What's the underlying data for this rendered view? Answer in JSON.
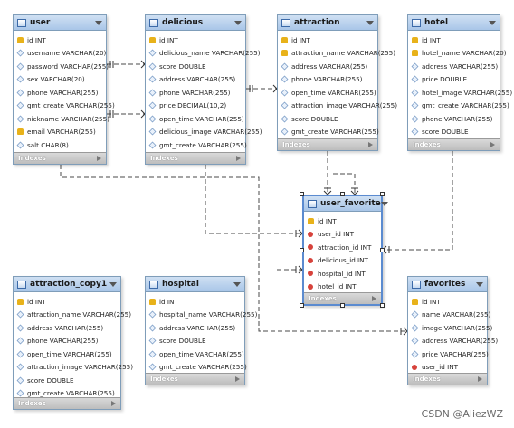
{
  "tables": [
    {
      "name": "user",
      "columns": [
        {
          "icon": "key",
          "text": "id INT"
        },
        {
          "icon": "col",
          "text": "username VARCHAR(20)"
        },
        {
          "icon": "col",
          "text": "password VARCHAR(255)"
        },
        {
          "icon": "col",
          "text": "sex VARCHAR(20)"
        },
        {
          "icon": "col",
          "text": "phone VARCHAR(255)"
        },
        {
          "icon": "col",
          "text": "gmt_create VARCHAR(255)"
        },
        {
          "icon": "col",
          "text": "nickname VARCHAR(255)"
        },
        {
          "icon": "key",
          "text": "email VARCHAR(255)"
        },
        {
          "icon": "col",
          "text": "salt CHAR(8)"
        }
      ],
      "footer": "Indexes"
    },
    {
      "name": "delicious",
      "columns": [
        {
          "icon": "key",
          "text": "id INT"
        },
        {
          "icon": "col",
          "text": "delicious_name VARCHAR(255)"
        },
        {
          "icon": "col",
          "text": "score DOUBLE"
        },
        {
          "icon": "col",
          "text": "address VARCHAR(255)"
        },
        {
          "icon": "col",
          "text": "phone VARCHAR(255)"
        },
        {
          "icon": "col",
          "text": "price DECIMAL(10,2)"
        },
        {
          "icon": "col",
          "text": "open_time VARCHAR(255)"
        },
        {
          "icon": "col",
          "text": "delicious_image VARCHAR(255)"
        },
        {
          "icon": "col",
          "text": "gmt_create VARCHAR(255)"
        }
      ],
      "footer": "Indexes"
    },
    {
      "name": "attraction",
      "columns": [
        {
          "icon": "key",
          "text": "id INT"
        },
        {
          "icon": "key",
          "text": "attraction_name VARCHAR(255)"
        },
        {
          "icon": "col",
          "text": "address VARCHAR(255)"
        },
        {
          "icon": "col",
          "text": "phone VARCHAR(255)"
        },
        {
          "icon": "col",
          "text": "open_time VARCHAR(255)"
        },
        {
          "icon": "col",
          "text": "attraction_image VARCHAR(255)"
        },
        {
          "icon": "col",
          "text": "score DOUBLE"
        },
        {
          "icon": "col",
          "text": "gmt_create VARCHAR(255)"
        }
      ],
      "footer": "Indexes"
    },
    {
      "name": "hotel",
      "columns": [
        {
          "icon": "key",
          "text": "id INT"
        },
        {
          "icon": "key",
          "text": "hotel_name VARCHAR(20)"
        },
        {
          "icon": "col",
          "text": "address VARCHAR(255)"
        },
        {
          "icon": "col",
          "text": "price DOUBLE"
        },
        {
          "icon": "col",
          "text": "hotel_image VARCHAR(255)"
        },
        {
          "icon": "col",
          "text": "gmt_create VARCHAR(255)"
        },
        {
          "icon": "col",
          "text": "phone VARCHAR(255)"
        },
        {
          "icon": "col",
          "text": "score DOUBLE"
        }
      ],
      "footer": "Indexes"
    },
    {
      "name": "user_favorite",
      "columns": [
        {
          "icon": "key",
          "text": "id INT"
        },
        {
          "icon": "fk",
          "text": "user_id INT"
        },
        {
          "icon": "fk",
          "text": "attraction_id INT"
        },
        {
          "icon": "fk",
          "text": "delicious_id INT"
        },
        {
          "icon": "fk",
          "text": "hospital_id INT"
        },
        {
          "icon": "fk",
          "text": "hotel_id INT"
        }
      ],
      "footer": "Indexes"
    },
    {
      "name": "attraction_copy1",
      "columns": [
        {
          "icon": "key",
          "text": "id INT"
        },
        {
          "icon": "col",
          "text": "attraction_name VARCHAR(255)"
        },
        {
          "icon": "col",
          "text": "address VARCHAR(255)"
        },
        {
          "icon": "col",
          "text": "phone VARCHAR(255)"
        },
        {
          "icon": "col",
          "text": "open_time VARCHAR(255)"
        },
        {
          "icon": "col",
          "text": "attraction_image VARCHAR(255)"
        },
        {
          "icon": "col",
          "text": "score DOUBLE"
        },
        {
          "icon": "col",
          "text": "gmt_create VARCHAR(255)"
        }
      ],
      "footer": "Indexes"
    },
    {
      "name": "hospital",
      "columns": [
        {
          "icon": "key",
          "text": "id INT"
        },
        {
          "icon": "col",
          "text": "hospital_name VARCHAR(255)"
        },
        {
          "icon": "col",
          "text": "address VARCHAR(255)"
        },
        {
          "icon": "col",
          "text": "score DOUBLE"
        },
        {
          "icon": "col",
          "text": "open_time VARCHAR(255)"
        },
        {
          "icon": "col",
          "text": "gmt_create VARCHAR(255)"
        }
      ],
      "footer": "Indexes"
    },
    {
      "name": "favorites",
      "columns": [
        {
          "icon": "key",
          "text": "id INT"
        },
        {
          "icon": "col",
          "text": "name VARCHAR(255)"
        },
        {
          "icon": "col",
          "text": "image VARCHAR(255)"
        },
        {
          "icon": "col",
          "text": "address VARCHAR(255)"
        },
        {
          "icon": "col",
          "text": "price VARCHAR(255)"
        },
        {
          "icon": "fk",
          "text": "user_id INT"
        }
      ],
      "footer": "Indexes"
    }
  ],
  "watermark": "CSDN @AliezWZ",
  "colors": {
    "header": "#a9c6e8",
    "border": "#7f9db9",
    "footer": "#bdbdbd",
    "line": "#555555"
  }
}
